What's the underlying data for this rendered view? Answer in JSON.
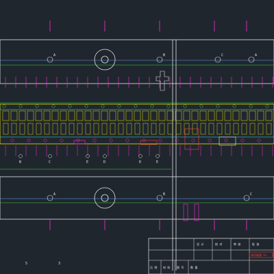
{
  "drawing": {
    "background": "#20262e",
    "colors": {
      "outline": "#e6e6e6",
      "centerline": "#5fa8ff",
      "green": "#35e035",
      "yellow": "#e8e800",
      "magenta": "#ff2bd6",
      "red": "#ff4040",
      "cyan": "#3ff0ff"
    },
    "guide_top": [
      {
        "label": "A"
      },
      {
        "label": "B"
      },
      {
        "label": "A"
      },
      {
        "label": "C"
      }
    ],
    "guide_bottom": [
      {
        "label": "A"
      },
      {
        "label": "B"
      },
      {
        "label": "C"
      }
    ],
    "mid_labels": [
      "B",
      "C",
      "E",
      "D",
      "D",
      "E"
    ],
    "bottom_marks": [
      "5",
      "3"
    ]
  },
  "title_block": {
    "row1": [
      "设 计",
      "校 对",
      "审 核",
      "批 准"
    ],
    "row2": [
      "",
      "",
      "",
      ""
    ],
    "footer": [
      "比 例",
      "材 料",
      "图 号",
      "数 量"
    ],
    "red_label": "线切割图 A1 - 1"
  }
}
